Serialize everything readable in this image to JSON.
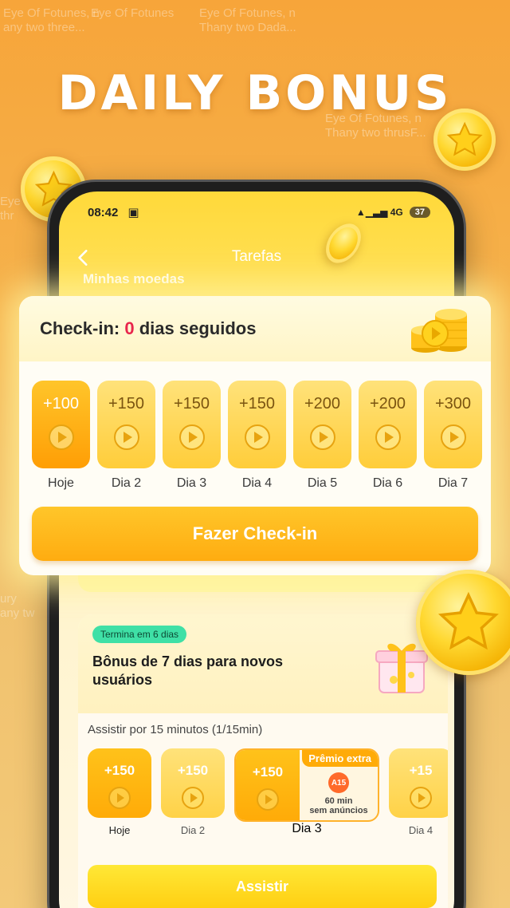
{
  "headline": "DAILY BONUS",
  "background_tiles": [
    "Eye Of Fotunes, n\nany two three...",
    "Eye Of Fotunes",
    "Eye Of Fotunes, n\nThany two Dada...",
    "Eye Of Fotunes, n\nThany two thrusF...",
    "Eye\nthr",
    "ury\nany tw"
  ],
  "status_bar": {
    "time": "08:42",
    "signal": "▲▁▃▅ 4G",
    "battery": "37"
  },
  "nav": {
    "title": "Tarefas",
    "back_icon": "chevron-left-icon"
  },
  "my_coins_label": "Minhas moedas",
  "checkin": {
    "title_prefix": "Check-in: ",
    "streak": "0",
    "title_suffix": " dias seguidos",
    "days": [
      {
        "amount": "+100",
        "label": "Hoje"
      },
      {
        "amount": "+150",
        "label": "Dia 2"
      },
      {
        "amount": "+150",
        "label": "Dia 3"
      },
      {
        "amount": "+150",
        "label": "Dia 4"
      },
      {
        "amount": "+200",
        "label": "Dia 5"
      },
      {
        "amount": "+200",
        "label": "Dia 6"
      },
      {
        "amount": "+300",
        "label": "Dia 7"
      }
    ],
    "button_label": "Fazer Check-in"
  },
  "new_user_bonus": {
    "badge": "Termina em 6 dias",
    "title": "Bônus de 7 dias para novos usuários",
    "watch_label": "Assistir por 15 minutos (1/15min)",
    "tiles": [
      {
        "amount": "+150",
        "label": "Hoje"
      },
      {
        "amount": "+150",
        "label": "Dia 2"
      }
    ],
    "extra": {
      "amount": "+150",
      "label": "Dia 3",
      "tag": "Prêmio extra",
      "reward_line1": "60 min",
      "reward_line2": "sem anúncios",
      "badge_text": "A15"
    },
    "partial_tile": {
      "amount": "+15",
      "label": "Dia 4"
    },
    "button_label": "Assistir"
  },
  "colors": {
    "accent": "#ffac10",
    "streak_red": "#e8264c",
    "badge_green": "#3fe0a6"
  }
}
